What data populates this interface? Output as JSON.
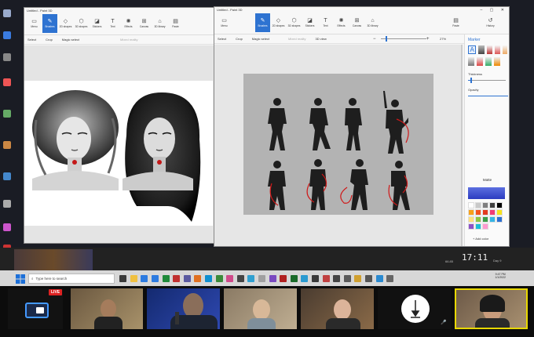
{
  "left_window": {
    "title": "Untitled - Paint 3D",
    "ribbon": [
      "Menu",
      "Brushes",
      "2D shapes",
      "3D shapes",
      "Stickers",
      "Text",
      "Effects",
      "Canvas",
      "3D library",
      "Paste"
    ],
    "toolbar": [
      "Select",
      "Crop",
      "Magic select",
      "Mixed reality"
    ]
  },
  "right_window": {
    "title": "Untitled - Paint 3D",
    "ribbon": [
      "Menu",
      "Brushes",
      "2D shapes",
      "3D shapes",
      "Stickers",
      "Text",
      "Effects",
      "Canvas",
      "3D library"
    ],
    "ribbon_right": [
      "Paste",
      "History"
    ],
    "toolbar": [
      "Select",
      "Crop",
      "Magic select",
      "Mixed reality",
      "3D view"
    ],
    "zoom": "27%",
    "panel": {
      "title": "Marker",
      "thickness_label": "Thickness",
      "opacity_label": "Opacity",
      "matte_label": "Matte",
      "add_color_label": "+ Add color",
      "palette": [
        "#ffffff",
        "#c9c9c9",
        "#7f7f7f",
        "#3f3f3f",
        "#000000",
        "#f7a11a",
        "#f4551d",
        "#e23a1e",
        "#f23b75",
        "#f6e31b",
        "#ffe17c",
        "#90c540",
        "#3a9d47",
        "#35b5e5",
        "#2b6fd2",
        "#8c52c7",
        "#1bbfd6",
        "#ff9ad0"
      ]
    }
  },
  "taskbar": {
    "search_placeholder": "Type here to search",
    "time": "9:47 PM",
    "date": "1/1/2022"
  },
  "overlay": {
    "clock": "17:11",
    "day": "Day 9",
    "stat": "66.85"
  },
  "stream": {
    "live_label": "LIVE"
  },
  "colors": {
    "accent": "#2e73d1",
    "live": "#dd2222",
    "highlight": "#e8d800"
  }
}
